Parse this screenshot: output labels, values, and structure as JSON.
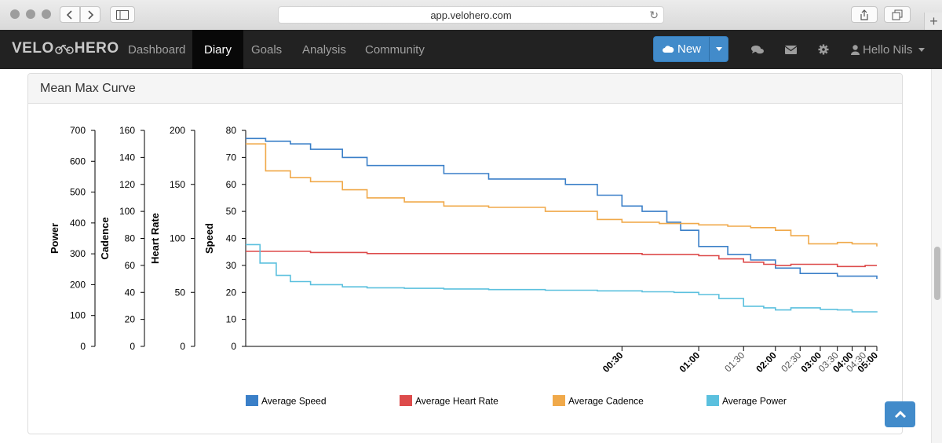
{
  "browser": {
    "url": "app.velohero.com"
  },
  "nav": {
    "logo_left": "VELO",
    "logo_right": "HERO",
    "items": [
      {
        "label": "Dashboard",
        "active": false
      },
      {
        "label": "Diary",
        "active": true
      },
      {
        "label": "Goals",
        "active": false
      },
      {
        "label": "Analysis",
        "active": false
      },
      {
        "label": "Community",
        "active": false
      }
    ],
    "new_label": "New",
    "user_label": "Hello Nils",
    "icons": [
      "cloud-icon",
      "caret-down-icon",
      "comments-icon",
      "envelope-icon",
      "gear-icon",
      "user-icon"
    ]
  },
  "panel": {
    "title": "Mean Max Curve"
  },
  "colors": {
    "speed": "#3a7fc8",
    "heart_rate": "#dd4b4b",
    "cadence": "#f0a94a",
    "power": "#5bc0de",
    "accent": "#428bca"
  },
  "chart_data": {
    "type": "line",
    "x_tick_labels": [
      "00:30",
      "01:00",
      "01:30",
      "02:00",
      "02:30",
      "03:00",
      "03:30",
      "04:00",
      "04:30",
      "05:00"
    ],
    "x_tick_bold": [
      true,
      true,
      false,
      true,
      false,
      true,
      false,
      true,
      false,
      true
    ],
    "x_ticks": [
      0.5,
      1,
      1.5,
      2,
      2.5,
      3,
      3.5,
      4,
      4.5,
      5
    ],
    "x_scale": "log",
    "xlim": [
      0.0167,
      5
    ],
    "axes": [
      {
        "label": "Power",
        "ticks": [
          0,
          100,
          200,
          300,
          400,
          500,
          600,
          700
        ],
        "ylim": [
          0,
          700
        ]
      },
      {
        "label": "Cadence",
        "ticks": [
          0,
          20,
          40,
          60,
          80,
          100,
          120,
          140,
          160
        ],
        "ylim": [
          0,
          160
        ]
      },
      {
        "label": "Heart Rate",
        "ticks": [
          0,
          50,
          100,
          150,
          200
        ],
        "ylim": [
          0,
          200
        ]
      },
      {
        "label": "Speed",
        "ticks": [
          0,
          10,
          20,
          30,
          40,
          50,
          60,
          70,
          80
        ],
        "ylim": [
          0,
          80
        ]
      }
    ],
    "series": [
      {
        "name": "Average Speed",
        "axis": 3,
        "color": "#3a7fc8",
        "x": [
          0.0167,
          0.02,
          0.025,
          0.03,
          0.04,
          0.05,
          0.07,
          0.1,
          0.15,
          0.22,
          0.3,
          0.4,
          0.5,
          0.6,
          0.75,
          0.85,
          1.0,
          1.3,
          1.6,
          2.0,
          2.5,
          3.0,
          3.5,
          4.0,
          5.0
        ],
        "y": [
          77,
          76,
          75,
          73,
          70,
          67,
          67,
          64,
          62,
          62,
          60,
          56,
          52,
          50,
          46,
          43,
          37,
          34,
          32,
          29,
          27,
          27,
          26,
          26,
          25
        ]
      },
      {
        "name": "Average Heart Rate",
        "axis": 2,
        "color": "#dd4b4b",
        "x": [
          0.0167,
          0.03,
          0.05,
          0.1,
          0.2,
          0.3,
          0.5,
          0.6,
          0.8,
          1.0,
          1.2,
          1.5,
          1.8,
          2.0,
          2.3,
          2.7,
          3.0,
          3.5,
          4.0,
          4.5,
          5.0
        ],
        "y": [
          88,
          87,
          86,
          86,
          86,
          86,
          86,
          85,
          85,
          84,
          81,
          78,
          76,
          75,
          76,
          76,
          76,
          74,
          74,
          75,
          75
        ]
      },
      {
        "name": "Average Cadence",
        "axis": 1,
        "color": "#f0a94a",
        "x": [
          0.0167,
          0.02,
          0.025,
          0.03,
          0.04,
          0.05,
          0.07,
          0.1,
          0.15,
          0.25,
          0.4,
          0.5,
          0.7,
          1.0,
          1.3,
          1.6,
          2.0,
          2.3,
          2.7,
          3.0,
          3.5,
          4.0,
          5.0
        ],
        "y": [
          150,
          130,
          125,
          122,
          116,
          110,
          107,
          104,
          103,
          100,
          94,
          92,
          91,
          90,
          89,
          88,
          86,
          82,
          76,
          76,
          77,
          76,
          74
        ]
      },
      {
        "name": "Average Power",
        "axis": 0,
        "color": "#5bc0de",
        "x": [
          0.0167,
          0.019,
          0.022,
          0.025,
          0.03,
          0.04,
          0.05,
          0.07,
          0.1,
          0.15,
          0.25,
          0.4,
          0.6,
          0.8,
          1.0,
          1.2,
          1.5,
          1.8,
          2.0,
          2.3,
          2.7,
          3.0,
          3.5,
          4.0,
          5.0
        ],
        "y": [
          330,
          270,
          230,
          210,
          200,
          193,
          190,
          188,
          186,
          184,
          182,
          180,
          177,
          175,
          168,
          155,
          130,
          125,
          118,
          125,
          125,
          120,
          118,
          112,
          110
        ]
      }
    ]
  }
}
